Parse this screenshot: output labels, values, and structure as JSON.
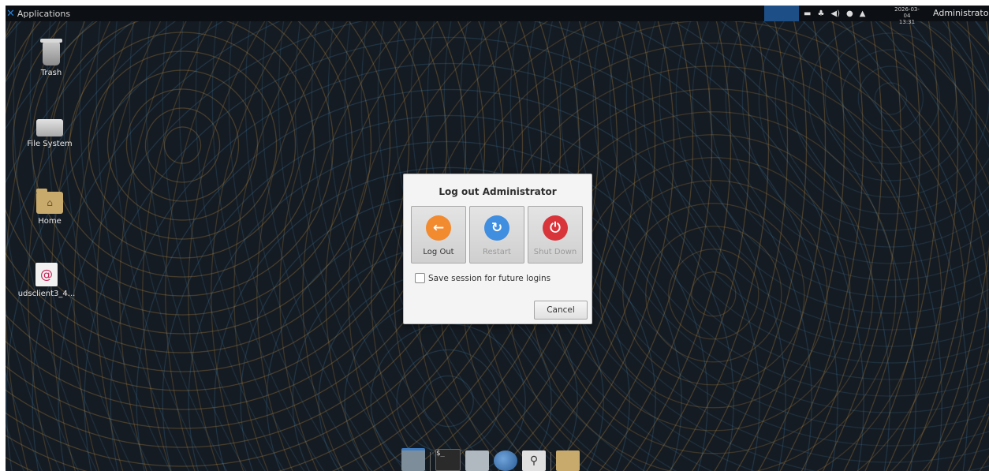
{
  "top_panel": {
    "apps_label": "Applications",
    "clock_date": "2026-03-04",
    "clock_time": "13:31",
    "user": "Administrator",
    "tray_icons": [
      "keyboard-icon",
      "network-icon",
      "volume-icon",
      "update-icon",
      "notification-icon"
    ]
  },
  "desktop_icons": [
    {
      "label": "Trash",
      "icon": "trash-icon"
    },
    {
      "label": "File System",
      "icon": "drive-icon"
    },
    {
      "label": "Home",
      "icon": "home-folder-icon"
    },
    {
      "label": "udsclient3_4...",
      "icon": "debian-package-icon"
    }
  ],
  "dialog": {
    "title": "Log out Administrator",
    "buttons": [
      {
        "label": "Log Out",
        "icon": "logout-arrow-icon",
        "color": "#f28a30",
        "enabled": true
      },
      {
        "label": "Restart",
        "icon": "restart-icon",
        "color": "#3f8ee0",
        "enabled": false
      },
      {
        "label": "Shut Down",
        "icon": "power-icon",
        "color": "#d9343a",
        "enabled": false
      }
    ],
    "save_session_label": "Save session for future logins",
    "save_session_checked": false,
    "cancel_label": "Cancel"
  },
  "dock": {
    "items": [
      "show-desktop-icon",
      "terminal-icon",
      "file-manager-icon",
      "web-browser-icon",
      "app-finder-icon",
      "folder-icon"
    ]
  }
}
